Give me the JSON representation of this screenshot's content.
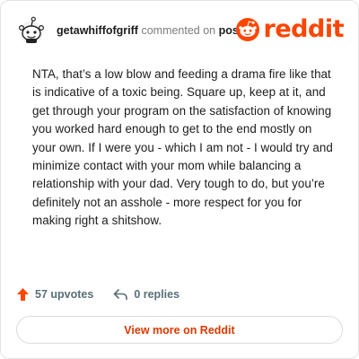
{
  "header": {
    "username": "getawhiffofgriff",
    "action_text": "commented on",
    "post_link": "post",
    "logo_text": "reddit"
  },
  "comment": {
    "text": "NTA, that’s a low blow and feeding a drama fire like that is indicative of a toxic being. Square up, keep at it, and get through your program on the satisfaction of knowing you worked hard enough to get to the end mostly on your own. If I were you - which I am not - I would try and minimize contact with your mom while balancing a relationship with your dad. Very tough to do, but you’re definitely not an asshole - more respect for you for making right a shitshow."
  },
  "actions": {
    "upvotes": "57 upvotes",
    "replies": "0 replies"
  },
  "footer": {
    "view_label": "View more on Reddit"
  },
  "colors": {
    "brand": "#ff4500",
    "link": "#d93900",
    "muted": "#576f76"
  },
  "icons": [
    "avatar-icon",
    "reddit-logo-icon",
    "upvote-icon",
    "reply-icon"
  ]
}
